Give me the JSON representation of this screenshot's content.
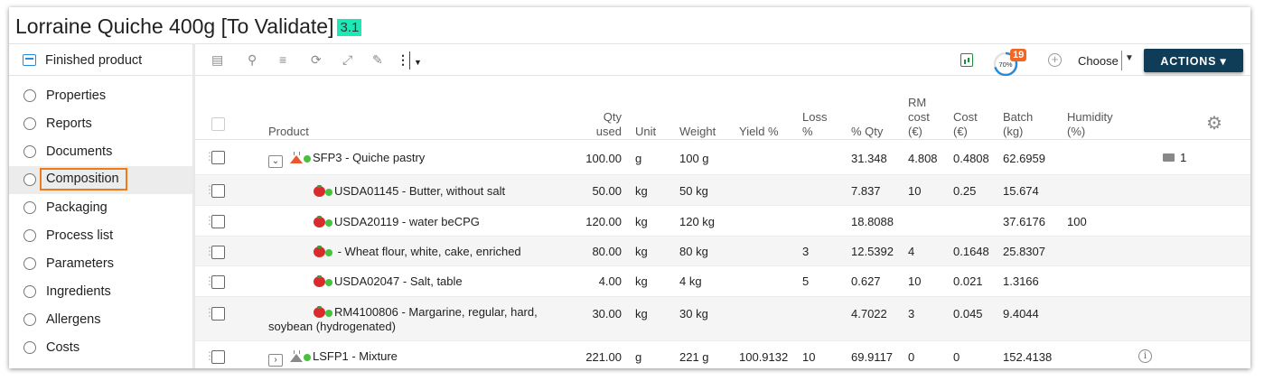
{
  "title": {
    "text": "Lorraine Quiche 400g [To Validate]",
    "version": "3.1"
  },
  "sidebar": {
    "header": "Finished product",
    "items": [
      {
        "label": "Properties"
      },
      {
        "label": "Reports"
      },
      {
        "label": "Documents"
      },
      {
        "label": "Composition",
        "active": true
      },
      {
        "label": "Packaging"
      },
      {
        "label": "Process list"
      },
      {
        "label": "Parameters"
      },
      {
        "label": "Ingredients"
      },
      {
        "label": "Allergens"
      },
      {
        "label": "Costs"
      }
    ]
  },
  "toolbar": {
    "icons": [
      "export-icon",
      "search-icon",
      "add-row-icon",
      "refresh-icon",
      "fullscreen-icon",
      "edit-icon",
      "more-icon",
      "dropdown-icon"
    ],
    "progress_percent": 70,
    "progress_label": "70%",
    "notification_count": "19",
    "choose_label": "Choose",
    "actions_label": "ACTIONS ▾",
    "colors": {
      "actions_bg": "#0f3c57",
      "badge": "#f26522",
      "accent": "#2a8ad6"
    }
  },
  "grid": {
    "columns": {
      "product": "Product",
      "qty_used_1": "Qty",
      "qty_used_2": "used",
      "unit": "Unit",
      "weight": "Weight",
      "yield": "Yield %",
      "loss_1": "Loss",
      "loss_2": "%",
      "pct_qty": "% Qty",
      "rm_cost_1": "RM",
      "rm_cost_2": "cost",
      "rm_cost_3": "(€)",
      "cost_1": "Cost",
      "cost_2": "(€)",
      "batch_1": "Batch",
      "batch_2": "(kg)",
      "humidity_1": "Humidity",
      "humidity_2": "(%)"
    },
    "rows": [
      {
        "product": "SFP3 - Quiche pastry",
        "qty": "100.00",
        "unit": "g",
        "weight": "100 g",
        "yield": "",
        "loss": "",
        "pct_qty": "31.348",
        "rm_cost": "4.808",
        "cost": "0.4808",
        "batch": "62.6959",
        "humidity": "",
        "packaging_count": "1"
      },
      {
        "product": "USDA01145 - Butter, without salt",
        "qty": "50.00",
        "unit": "kg",
        "weight": "50 kg",
        "yield": "",
        "loss": "",
        "pct_qty": "7.837",
        "rm_cost": "10",
        "cost": "0.25",
        "batch": "15.674",
        "humidity": ""
      },
      {
        "product": "USDA20119 - water beCPG",
        "qty": "120.00",
        "unit": "kg",
        "weight": "120 kg",
        "yield": "",
        "loss": "",
        "pct_qty": "18.8088",
        "rm_cost": "",
        "cost": "",
        "batch": "37.6176",
        "humidity": "100"
      },
      {
        "product": " - Wheat flour, white, cake, enriched",
        "qty": "80.00",
        "unit": "kg",
        "weight": "80 kg",
        "yield": "",
        "loss": "3",
        "pct_qty": "12.5392",
        "rm_cost": "4",
        "cost": "0.1648",
        "batch": "25.8307",
        "humidity": ""
      },
      {
        "product": "USDA02047 - Salt, table",
        "qty": "4.00",
        "unit": "kg",
        "weight": "4 kg",
        "yield": "",
        "loss": "5",
        "pct_qty": "0.627",
        "rm_cost": "10",
        "cost": "0.021",
        "batch": "1.3166",
        "humidity": ""
      },
      {
        "product_line1": "RM4100806 - Margarine, regular, hard,",
        "product_line2": "soybean (hydrogenated)",
        "qty": "30.00",
        "unit": "kg",
        "weight": "30 kg",
        "yield": "",
        "loss": "",
        "pct_qty": "4.7022",
        "rm_cost": "3",
        "cost": "0.045",
        "batch": "9.4044",
        "humidity": ""
      },
      {
        "product": "LSFP1 - Mixture",
        "qty": "221.00",
        "unit": "g",
        "weight": "221 g",
        "yield": "100.9132",
        "loss": "10",
        "pct_qty": "69.9117",
        "rm_cost": "0",
        "cost": "0",
        "batch": "152.4138",
        "humidity": ""
      }
    ]
  }
}
